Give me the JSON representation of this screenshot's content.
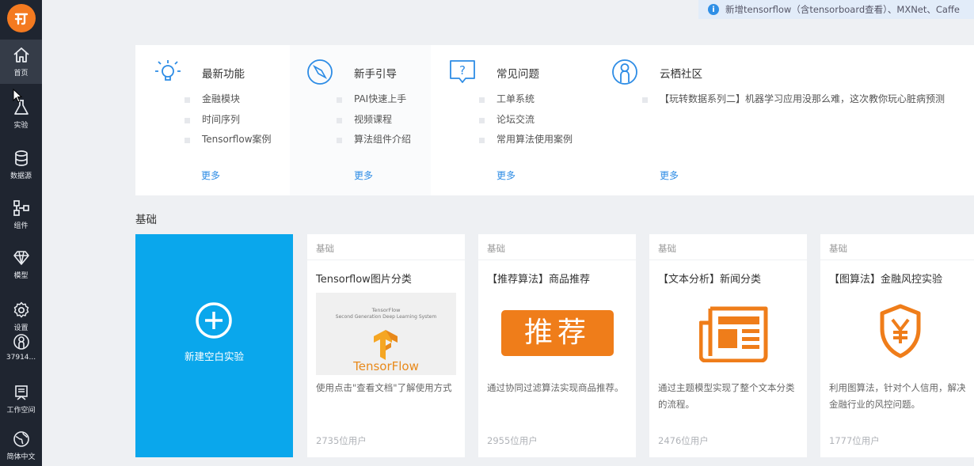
{
  "sidebar": {
    "items": [
      {
        "label": "首页",
        "icon": "home-icon"
      },
      {
        "label": "实验",
        "icon": "flask-icon"
      },
      {
        "label": "数据源",
        "icon": "database-icon"
      },
      {
        "label": "组件",
        "icon": "component-icon"
      },
      {
        "label": "模型",
        "icon": "diamond-icon"
      },
      {
        "label": "设置",
        "icon": "gear-icon"
      },
      {
        "label": "37914...",
        "icon": "user-icon"
      },
      {
        "label": "工作空间",
        "icon": "workspace-icon"
      },
      {
        "label": "简体中文",
        "icon": "globe-icon"
      }
    ]
  },
  "notice": {
    "text": "新增tensorflow（含tensorboard查看）、MXNet、Caffe"
  },
  "info": {
    "columns": [
      {
        "title": "最新功能",
        "icon": "lightbulb-icon",
        "items": [
          "金融模块",
          "时间序列",
          "Tensorflow案例"
        ],
        "more": "更多"
      },
      {
        "title": "新手引导",
        "icon": "compass-icon",
        "items": [
          "PAI快速上手",
          "视频课程",
          "算法组件介绍"
        ],
        "more": "更多"
      },
      {
        "title": "常见问题",
        "icon": "question-icon",
        "items": [
          "工单系统",
          "论坛交流",
          "常用算法使用案例"
        ],
        "more": "更多"
      },
      {
        "title": "云栖社区",
        "icon": "community-icon",
        "items": [
          "【玩转数据系列二】机器学习应用没那么难，这次教你玩心脏病预测"
        ],
        "more": "更多"
      }
    ]
  },
  "section": {
    "title": "基础"
  },
  "new_card": {
    "label": "新建空白实验"
  },
  "cards": [
    {
      "tag": "基础",
      "title": "Tensorflow图片分类",
      "desc": "使用点击\"查看文档\"了解使用方式",
      "users": "2735位用户",
      "thumb_title": "TensorFlow",
      "thumb_sub": "Second Generation Deep Learning System",
      "thumb_brand": "TensorFlow"
    },
    {
      "tag": "基础",
      "title": "【推荐算法】商品推荐",
      "desc": "通过协同过滤算法实现商品推荐。",
      "users": "2955位用户",
      "thumb_text": "推荐"
    },
    {
      "tag": "基础",
      "title": "【文本分析】新闻分类",
      "desc": "通过主题模型实现了整个文本分类的流程。",
      "users": "2476位用户"
    },
    {
      "tag": "基础",
      "title": "【图算法】金融风控实验",
      "desc": "利用图算法，针对个人信用，解决金融行业的风控问题。",
      "users": "1777位用户"
    }
  ],
  "colors": {
    "sidebar": "#1f2530",
    "accent": "#0aa7ec",
    "orange": "#f47a20",
    "link": "#2d8ce5"
  }
}
